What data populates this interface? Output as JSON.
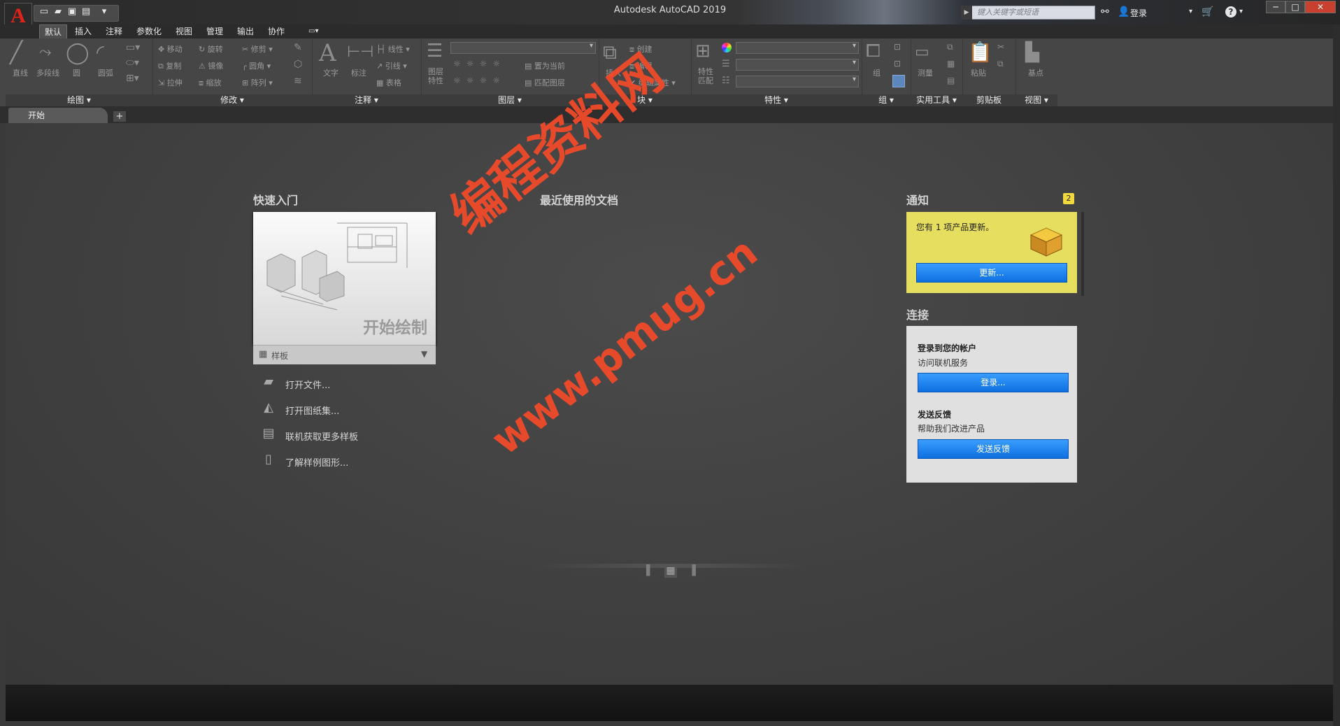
{
  "window": {
    "title": "Autodesk AutoCAD 2019",
    "search_placeholder": "键入关键字或短语",
    "login_label": "登录"
  },
  "menu_tabs": [
    "默认",
    "插入",
    "注释",
    "参数化",
    "视图",
    "管理",
    "输出",
    "协作"
  ],
  "ribbon": {
    "draw": {
      "title": "绘图",
      "line": "直线",
      "polyline": "多段线",
      "circle": "圆",
      "arc": "圆弧"
    },
    "modify": {
      "title": "修改",
      "move": "移动",
      "rotate": "旋转",
      "trim": "修剪",
      "copy": "复制",
      "mirror": "镜像",
      "fillet": "圆角",
      "stretch": "拉伸",
      "scale": "缩放",
      "array": "阵列"
    },
    "annotation": {
      "title": "注释",
      "text": "文字",
      "dimension": "标注",
      "linear": "线性",
      "leader": "引线",
      "table": "表格"
    },
    "layers": {
      "title": "图层",
      "layer_props": "图层特性",
      "set_current": "置为当前",
      "match_layer": "匹配图层"
    },
    "block": {
      "title": "块",
      "insert": "插入",
      "create": "创建",
      "edit": "编辑",
      "edit_attr": "编辑属性"
    },
    "properties": {
      "title": "特性",
      "match_props": "特性匹配"
    },
    "groups": {
      "title": "组",
      "group": "组"
    },
    "utilities": {
      "title": "实用工具",
      "measure": "测量"
    },
    "clipboard": {
      "title": "剪贴板",
      "paste": "粘贴"
    },
    "view": {
      "title": "视图",
      "base": "基点"
    }
  },
  "file_tabs": {
    "start": "开始",
    "add": "+"
  },
  "quick_start": {
    "title": "快速入门",
    "start_drawing": "开始绘制",
    "template_label": "样板",
    "links": [
      "打开文件...",
      "打开图纸集...",
      "联机获取更多样板",
      "了解样例图形..."
    ]
  },
  "recent_docs": {
    "title": "最近使用的文档"
  },
  "notifications": {
    "title": "通知",
    "count": "2",
    "message": "您有 1 项产品更新。",
    "update_button": "更新..."
  },
  "connect": {
    "title": "连接",
    "signin_heading": "登录到您的帐户",
    "signin_sub": "访问联机服务",
    "signin_button": "登录...",
    "feedback_heading": "发送反馈",
    "feedback_sub": "帮助我们改进产品",
    "feedback_button": "发送反馈"
  },
  "watermark": {
    "line1": "编程资料网",
    "line2": "www.pmug.cn"
  },
  "colors": {
    "accent_blue": "#1a7ff0",
    "notify_yellow": "#e6de5e",
    "autocad_red": "#e2231a"
  }
}
